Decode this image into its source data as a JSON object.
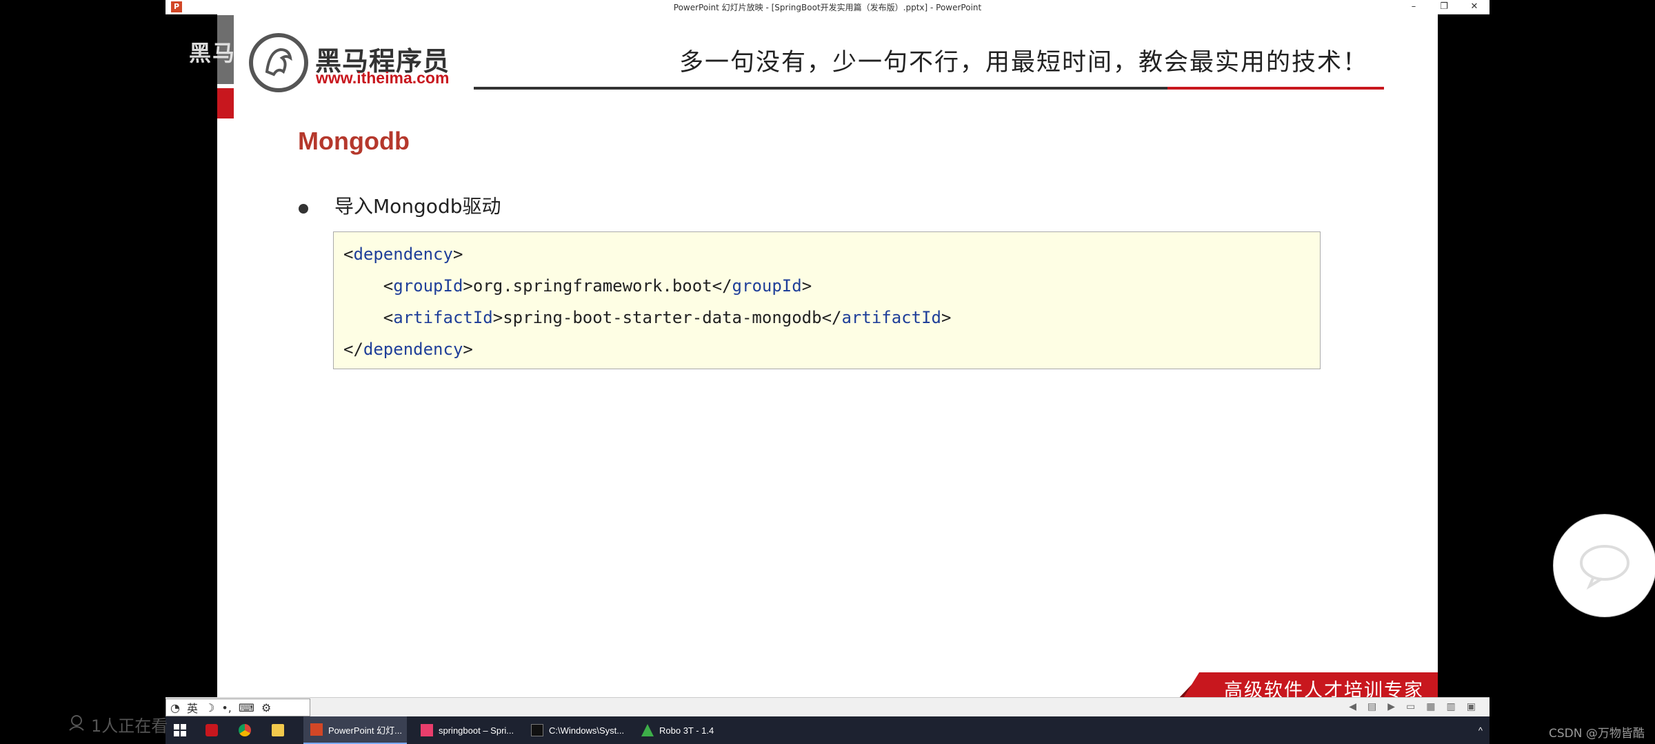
{
  "window": {
    "title": "PowerPoint 幻灯片放映 - [SpringBoot开发实用篇（发布版）.pptx] - PowerPoint",
    "minimize": "–",
    "restore": "❐",
    "close": "✕"
  },
  "slide": {
    "overlay_watermark": "黑马",
    "logo_title": "黑马程序员",
    "logo_url": "www.itheima.com",
    "slogan": "多一句没有，少一句不行，用最短时间，教会最实用的技术！",
    "heading": "Mongodb",
    "bullet": "导入Mongodb驱动",
    "code": [
      {
        "indent": "",
        "open_bracket": "<",
        "tag": "dependency",
        "close_bracket": ">",
        "text": "",
        "end_open": "",
        "end_tag": "",
        "end_close": ""
      },
      {
        "indent": "    ",
        "open_bracket": "<",
        "tag": "groupId",
        "close_bracket": ">",
        "text": "org.springframework.boot",
        "end_open": "</",
        "end_tag": "groupId",
        "end_close": ">"
      },
      {
        "indent": "    ",
        "open_bracket": "<",
        "tag": "artifactId",
        "close_bracket": ">",
        "text": "spring-boot-starter-data-mongodb",
        "end_open": "</",
        "end_tag": "artifactId",
        "end_close": ">"
      },
      {
        "indent": "",
        "open_bracket": "</",
        "tag": "dependency",
        "close_bracket": ">",
        "text": "",
        "end_open": "",
        "end_tag": "",
        "end_close": ""
      }
    ],
    "footer_banner": "高级软件人才培训专家"
  },
  "ime": {
    "lang": "英",
    "moon": "☽",
    "punct": "•,",
    "keyboard": "⌨",
    "gear": "⚙"
  },
  "taskbar": {
    "apps": [
      {
        "label": "PowerPoint 幻灯...",
        "icon": "powerpoint-icon",
        "color": "#d24726"
      },
      {
        "label": "springboot – Spri...",
        "icon": "intellij-icon",
        "color": "#e83e6c"
      },
      {
        "label": "C:\\Windows\\Syst...",
        "icon": "cmd-icon",
        "color": "#111111"
      },
      {
        "label": "Robo 3T - 1.4",
        "icon": "robo3t-icon",
        "color": "#3dae49"
      }
    ],
    "chevron": "^"
  },
  "overlay": {
    "viewers": "1人正在看",
    "csdn": "CSDN @万物皆酷"
  }
}
